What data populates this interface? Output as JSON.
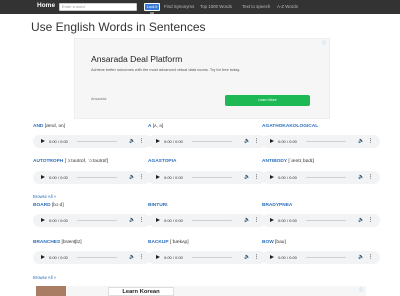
{
  "nav": {
    "home": "Home",
    "search_placeholder": "Enter a word",
    "lookup": "Look it up",
    "links": [
      "Find Synonyms",
      "Top 1000 Words",
      "Text to speech",
      "A-Z Words"
    ]
  },
  "page_title": "Use English Words in Sentences",
  "ad": {
    "mark": "ⓘ",
    "title": "Ansarada Deal Platform",
    "text": "Achieve better outcomes with the most advanced virtual data rooms. Try for free today.",
    "source": "Ansarada",
    "button": "Learn More"
  },
  "player_time": "0:00 / 0:00",
  "groups": [
    {
      "words": [
        {
          "word": "AND",
          "ipa": "[ænd, ən]"
        },
        {
          "word": "A",
          "ipa": "[ʌ, ə]"
        },
        {
          "word": "AGATHOKAKOLOGICAL",
          "ipa": ""
        },
        {
          "word": "AUTOTROPH",
          "ipa": "[ˈɔːtəʊtrɒf, ˈɔːtəʊtrɒf]"
        },
        {
          "word": "AGASTOPIA",
          "ipa": ""
        },
        {
          "word": "ANTIBODY",
          "ipa": "[ˈæntɪˌbɒdɪ]"
        }
      ],
      "browse": "Browse All »"
    },
    {
      "words": [
        {
          "word": "BOARD",
          "ipa": "[bɔːd]"
        },
        {
          "word": "BINTURI",
          "ipa": ""
        },
        {
          "word": "BRADYPNEA",
          "ipa": ""
        },
        {
          "word": "BRANCHES",
          "ipa": "[brænʧɪz]"
        },
        {
          "word": "BACKUP",
          "ipa": "[ˈbækʌp]"
        },
        {
          "word": "BOW",
          "ipa": "[baʊ]"
        }
      ],
      "browse": "Browse All »"
    }
  ],
  "bottom_ad": {
    "learn": "Learn Korean",
    "mark": "ⓘ"
  }
}
